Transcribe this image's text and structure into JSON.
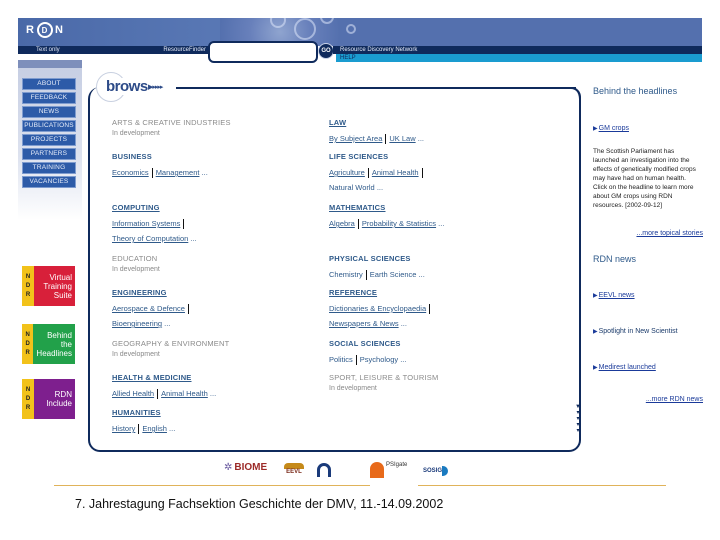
{
  "header": {
    "logo": [
      "R",
      "D",
      "N"
    ],
    "tagline": "Text only",
    "resource_finder_label": "ResourceFinder",
    "search_value": "",
    "go_label": "GO",
    "network_name": "Resource Discovery Network",
    "help_label": "HELP"
  },
  "sidebar": {
    "nav": [
      "ABOUT",
      "FEEDBACK",
      "NEWS",
      "PUBLICATIONS",
      "PROJECTS",
      "PARTNERS",
      "TRAINING",
      "VACANCIES"
    ],
    "promos": [
      {
        "tab": "RDN",
        "lines": [
          "Virtual",
          "Training",
          "Suite"
        ],
        "color": "#d8203a"
      },
      {
        "tab": "RDN",
        "lines": [
          "Behind",
          "the",
          "Headlines"
        ],
        "color": "#22a14a"
      },
      {
        "tab": "RDN",
        "lines": [
          "RDN",
          "Include"
        ],
        "color": "#7e1f8e"
      }
    ]
  },
  "browse": {
    "title": "browse",
    "arrows": "▶▸▸▸▸",
    "left": [
      {
        "title": "ARTS & CREATIVE INDUSTRIES",
        "status": "In development",
        "links": []
      },
      {
        "title": "BUSINESS",
        "links": [
          "Economics",
          "Management"
        ]
      },
      {
        "title": "COMPUTING",
        "links": [
          "Information Systems",
          "Theory of Computation"
        ]
      },
      {
        "title": "EDUCATION",
        "status": "In development",
        "links": []
      },
      {
        "title": "ENGINEERING",
        "links": [
          "Aerospace & Defence",
          "Bioengineering"
        ]
      },
      {
        "title": "GEOGRAPHY & ENVIRONMENT",
        "status": "In development",
        "links": []
      },
      {
        "title": "HEALTH & MEDICINE",
        "links": [
          "Allied Health",
          "Animal Health"
        ]
      },
      {
        "title": "HUMANITIES",
        "links": [
          "History",
          "English"
        ]
      }
    ],
    "right": [
      {
        "title": "LAW",
        "links": [
          "By Subject Area",
          "UK Law"
        ]
      },
      {
        "title": "LIFE SCIENCES",
        "links": [
          "Agriculture",
          "Animal Health",
          "Natural World"
        ]
      },
      {
        "title": "MATHEMATICS",
        "links": [
          "Algebra",
          "Probability & Statistics"
        ]
      },
      {
        "title": "PHYSICAL SCIENCES",
        "links": [
          "Chemistry",
          "Earth Science"
        ]
      },
      {
        "title": "REFERENCE",
        "links": [
          "Dictionaries & Encyclopaedia",
          "Newspapers & News"
        ]
      },
      {
        "title": "SOCIAL SCIENCES",
        "links": [
          "Politics",
          "Psychology"
        ]
      },
      {
        "title": "SPORT, LEISURE & TOURISM",
        "status": "In development",
        "links": []
      }
    ],
    "ellipsis": "..."
  },
  "headlines": {
    "title": "Behind the headlines",
    "story_link": "GM crops",
    "story_text": "The Scottish Parliament has launched an investigation into the effects of genetically modified crops may have had on human health. Click on the headline to learn more about GM crops using RDN resources. [2002-09-12]",
    "more_label": "...more topical stories"
  },
  "news": {
    "title": "RDN news",
    "items": [
      "EEVL news",
      "Spotlight in New Scientist",
      "Medirest launched"
    ],
    "more_label": "...more RDN news"
  },
  "partners": [
    "BIOME",
    "EEVL",
    "Humbul",
    "PSIgate",
    "SOSIG"
  ],
  "caption": "7. Jahrestagung Fachsektion Geschichte der DMV, 11.-14.09.2002"
}
